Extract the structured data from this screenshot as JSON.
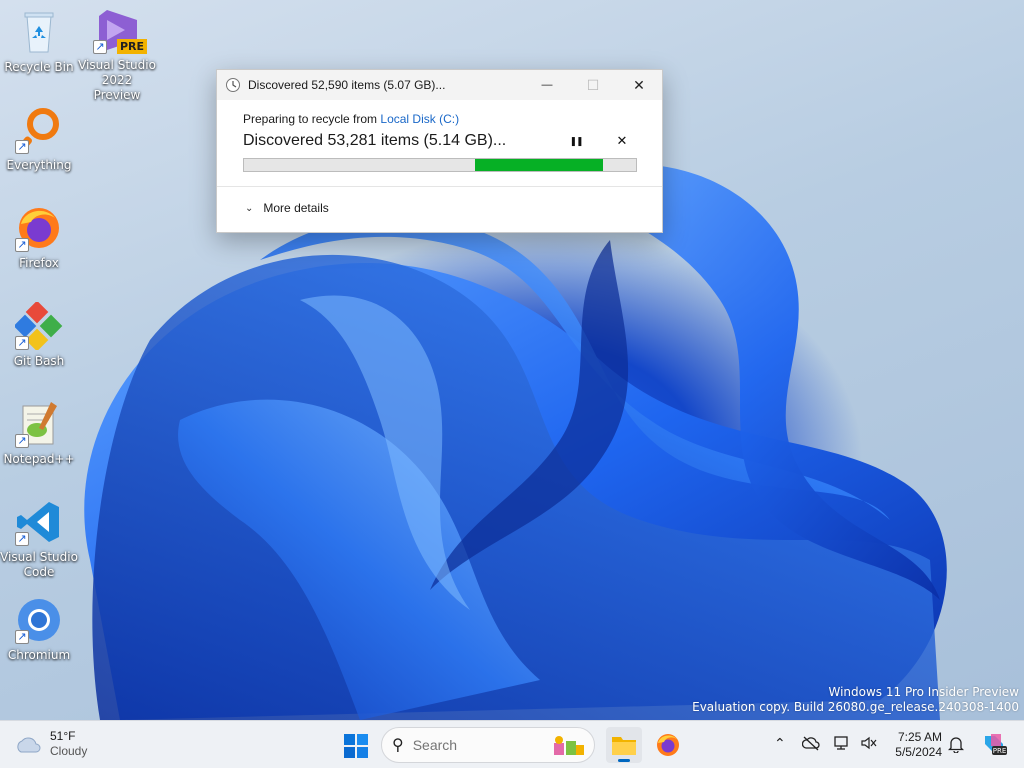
{
  "desktop": {
    "icons": [
      {
        "label_lines": [
          "Recycle Bin"
        ],
        "name": "recycle-bin"
      },
      {
        "label_lines": [
          "Visual Studio",
          "2022 Preview"
        ],
        "name": "visual-studio-preview",
        "badge": "PRE"
      },
      {
        "label_lines": [
          "Everything"
        ],
        "name": "everything"
      },
      {
        "label_lines": [
          "Firefox"
        ],
        "name": "firefox"
      },
      {
        "label_lines": [
          "Git Bash"
        ],
        "name": "git-bash"
      },
      {
        "label_lines": [
          "Notepad++"
        ],
        "name": "notepad-plus-plus"
      },
      {
        "label_lines": [
          "Visual Studio",
          "Code"
        ],
        "name": "vscode"
      },
      {
        "label_lines": [
          "Chromium"
        ],
        "name": "chromium"
      }
    ]
  },
  "dialog": {
    "title": "Discovered 52,590 items (5.07 GB)...",
    "preparing_prefix": "Preparing to recycle from ",
    "preparing_link": "Local Disk (C:)",
    "status": "Discovered 53,281 items (5.14 GB)...",
    "progress_start": 0.59,
    "progress_end": 0.915,
    "more_details": "More details",
    "minimize_glyph": "—",
    "maximize_glyph": "☐",
    "close_glyph": "✕",
    "pause_glyph": "❚❚",
    "cancel_glyph": "✕"
  },
  "watermark": {
    "line1": "Windows 11 Pro Insider Preview",
    "line2": "Evaluation copy. Build 26080.ge_release.240308-1400"
  },
  "taskbar": {
    "weather_temp": "51°F",
    "weather_cond": "Cloudy",
    "search_placeholder": "Search",
    "time": "7:25 AM",
    "date": "5/5/2024",
    "accent": "#0067c0"
  },
  "colors": {
    "progress_fill": "#06b025",
    "link": "#1a68c8"
  }
}
